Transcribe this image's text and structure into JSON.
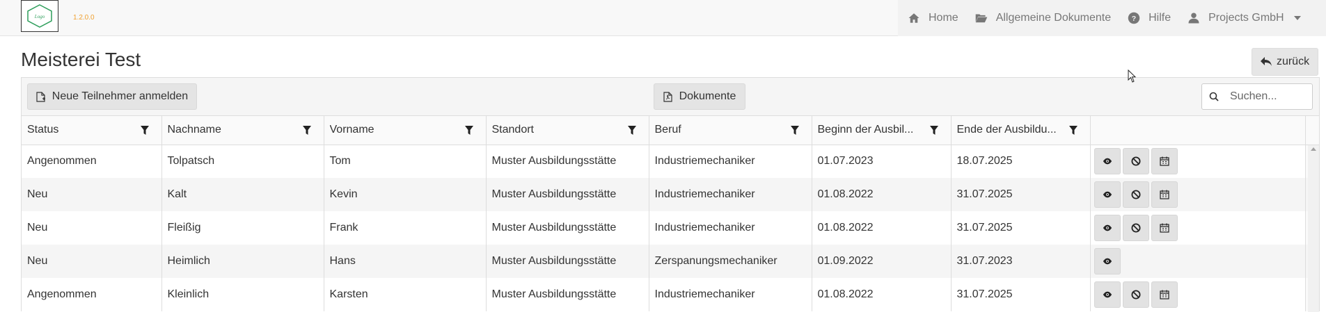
{
  "header": {
    "version": "1.2.0.0",
    "nav": [
      {
        "label": "Home",
        "icon": "home-icon"
      },
      {
        "label": "Allgemeine Dokumente",
        "icon": "folder-open-icon"
      },
      {
        "label": "Hilfe",
        "icon": "help-icon"
      },
      {
        "label": "Projects GmbH",
        "icon": "user-icon"
      }
    ]
  },
  "page": {
    "title": "Meisterei Test",
    "back_label": "zurück"
  },
  "toolbar": {
    "new_participant_label": "Neue Teilnehmer anmelden",
    "documents_label": "Dokumente",
    "search_placeholder": "Suchen..."
  },
  "table": {
    "columns": [
      "Status",
      "Nachname",
      "Vorname",
      "Standort",
      "Beruf",
      "Beginn der Ausbil...",
      "Ende der Ausbildu..."
    ],
    "rows": [
      [
        "Angenommen",
        "Tolpatsch",
        "Tom",
        "Muster Ausbildungsstätte",
        "Industriemechaniker",
        "01.07.2023",
        "18.07.2025"
      ],
      [
        "Neu",
        "Kalt",
        "Kevin",
        "Muster Ausbildungsstätte",
        "Industriemechaniker",
        "01.08.2022",
        "31.07.2025"
      ],
      [
        "Neu",
        "Fleißig",
        "Frank",
        "Muster Ausbildungsstätte",
        "Industriemechaniker",
        "01.08.2022",
        "31.07.2025"
      ],
      [
        "Neu",
        "Heimlich",
        "Hans",
        "Muster Ausbildungsstätte",
        "Zerspanungsmechaniker",
        "01.09.2022",
        "31.07.2023"
      ],
      [
        "Angenommen",
        "Kleinlich",
        "Karsten",
        "Muster Ausbildungsstätte",
        "Industriemechaniker",
        "01.08.2022",
        "31.07.2025"
      ]
    ],
    "row_actions": [
      [
        "view-icon",
        "block-icon",
        "calendar-icon"
      ],
      [
        "view-icon",
        "block-icon",
        "calendar-icon"
      ],
      [
        "view-icon",
        "block-icon",
        "calendar-icon"
      ],
      [
        "view-icon"
      ],
      [
        "view-icon",
        "block-icon",
        "calendar-icon"
      ]
    ]
  },
  "colors": {
    "version_text": "#f0a030",
    "logo_green": "#2e9e5b"
  }
}
